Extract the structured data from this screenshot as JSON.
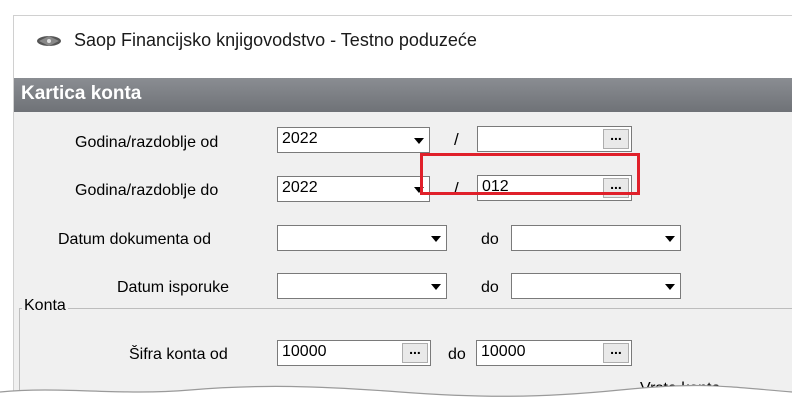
{
  "window": {
    "title": "Saop Financijsko knjigovodstvo - Testno poduzeće",
    "icon": "app-logo-icon"
  },
  "panel": {
    "title": "Kartica konta"
  },
  "form": {
    "godina_od": {
      "label": "Godina/razdoblje od",
      "year": "2022",
      "slash": "/",
      "period": "",
      "dots": "..."
    },
    "godina_do": {
      "label": "Godina/razdoblje do",
      "year": "2022",
      "slash": "/",
      "period": "012",
      "dots": "..."
    },
    "datum_dokumenta": {
      "label": "Datum dokumenta od",
      "from": "",
      "to_label": "do",
      "to": ""
    },
    "datum_isporuke": {
      "label": "Datum isporuke",
      "from": "",
      "to_label": "do",
      "to": ""
    },
    "konta": {
      "group_title": "Konta",
      "label": "Šifra konta od",
      "from": "10000",
      "to_label": "do",
      "to": "10000",
      "dots": "...",
      "vrsta_label": "Vrsta konta"
    }
  },
  "colors": {
    "highlight": "#e0202a",
    "panel_header": "#7a7d82"
  }
}
